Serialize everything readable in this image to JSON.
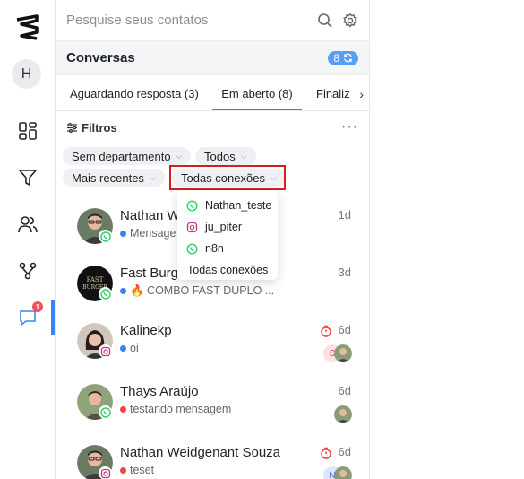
{
  "rail": {
    "avatar_initial": "H",
    "notification_count": "1"
  },
  "search": {
    "placeholder": "Pesquise seus contatos"
  },
  "conversations": {
    "title": "Conversas",
    "count": "8"
  },
  "tabs": [
    {
      "label": "Aguardando resposta (3)"
    },
    {
      "label": "Em aberto (8)"
    },
    {
      "label": "Finaliz"
    }
  ],
  "filters": {
    "label": "Filtros",
    "chips": [
      {
        "label": "Sem departamento"
      },
      {
        "label": "Todos"
      },
      {
        "label": "Mais recentes"
      },
      {
        "label": "Todas conexões"
      }
    ]
  },
  "dropdown": {
    "options": [
      {
        "label": "Nathan_teste",
        "icon": "whatsapp-icon"
      },
      {
        "label": "ju_piter",
        "icon": "instagram-icon"
      },
      {
        "label": "n8n",
        "icon": "whatsapp-icon"
      },
      {
        "label": "Todas conexões",
        "icon": ""
      }
    ]
  },
  "chats": [
    {
      "name": "Nathan W",
      "message": "Mensage",
      "time": "1d",
      "channel": "whatsapp",
      "dot": "#3b82f6"
    },
    {
      "name": "Fast Burg",
      "message": "🔥 COMBO FAST DUPLO ...",
      "time": "3d",
      "channel": "whatsapp",
      "dot": "#3b82f6"
    },
    {
      "name": "Kalinekp",
      "message": "oi",
      "time": "6d",
      "channel": "instagram",
      "dot": "#3b82f6"
    },
    {
      "name": "Thays Araújo",
      "message": "testando mensagem",
      "time": "6d",
      "channel": "whatsapp",
      "dot": "#ef4444"
    },
    {
      "name": "Nathan Weidgenant Souza",
      "message": "teset",
      "time": "6d",
      "channel": "instagram",
      "dot": "#ef4444"
    }
  ],
  "mini_avatars": {
    "s_initial": "S",
    "n_initial": "N"
  },
  "colors": {
    "accent": "#3b82f6",
    "whatsapp": "#25d366",
    "instagram": "#c13584",
    "highlight": "#d91c1c"
  }
}
